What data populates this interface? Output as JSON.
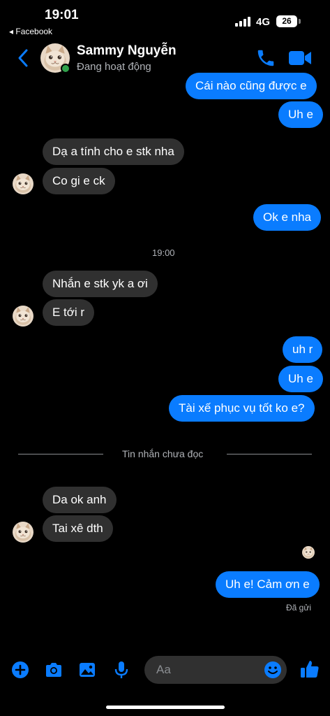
{
  "status_bar": {
    "time": "19:01",
    "back_app": "◂ Facebook",
    "network": "4G",
    "battery": "26"
  },
  "header": {
    "contact_name": "Sammy Nguyễn",
    "contact_status": "Đang hoạt động",
    "icons": [
      "back-chevron-icon",
      "phone-icon",
      "video-camera-icon"
    ]
  },
  "messages": [
    {
      "side": "out",
      "text": "Cái nào cũng được e"
    },
    {
      "side": "out",
      "text": "Uh e"
    },
    {
      "side": "in",
      "text": "Dạ a tính cho e stk nha"
    },
    {
      "side": "in",
      "text": "Co gi e ck"
    },
    {
      "side": "out",
      "text": "Ok e nha"
    },
    {
      "side": "in",
      "text": "Nhắn e stk yk a ơi"
    },
    {
      "side": "in",
      "text": "E tới r"
    },
    {
      "side": "out",
      "text": "uh r"
    },
    {
      "side": "out",
      "text": "Uh e"
    },
    {
      "side": "out",
      "text": "Tài xế phục vụ tốt ko e?"
    },
    {
      "side": "in",
      "text": "Da ok anh"
    },
    {
      "side": "in",
      "text": "Tai xê dth"
    },
    {
      "side": "out",
      "text": "Uh e! Cảm ơn e"
    }
  ],
  "timestamp": "19:00",
  "unread_divider": "Tin nhắn chưa đọc",
  "sent_status": "Đã gửi",
  "composer": {
    "placeholder": "Aa",
    "icons": [
      "plus-circle-icon",
      "camera-icon",
      "image-icon",
      "microphone-icon",
      "emoji-icon",
      "thumbs-up-icon"
    ]
  },
  "colors": {
    "accent": "#0a7cff",
    "incoming_bubble": "#303030",
    "online": "#31a24c",
    "background": "#000000"
  }
}
